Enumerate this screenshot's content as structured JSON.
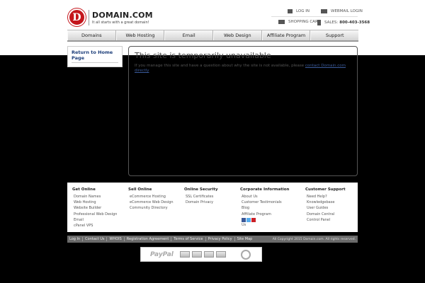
{
  "header": {
    "logo_letter": "D",
    "logo_name": "DOMAIN.COM",
    "logo_tagline": "It all starts with a great domain!",
    "login": "LOG IN",
    "webmail": "WEBMAIL LOGIN",
    "cart": "SHOPPING CART",
    "sales_label": "SALES:",
    "sales_phone": "800-403-3568"
  },
  "nav": [
    "Domains",
    "Web Hosting",
    "Email",
    "Web Design",
    "Affiliate Program",
    "Support"
  ],
  "sidebar": {
    "link": "Return to Home Page"
  },
  "main": {
    "title": "This site is temporarily unavailable",
    "message": "If you manage this site and have a question about why the site is not available, please",
    "contact_link": "contact Domain.com directly"
  },
  "footer": {
    "columns": [
      {
        "title": "Get Online",
        "links": [
          "Domain Names",
          "Web Hosting",
          "Website Builder",
          "Professional Web Design",
          "Email",
          "cPanel VPS"
        ]
      },
      {
        "title": "Sell Online",
        "links": [
          "eCommerce Hosting",
          "eCommerce Web Design",
          "Community Directory"
        ]
      },
      {
        "title": "Online Security",
        "links": [
          "SSL Certificates",
          "Domain Privacy"
        ]
      },
      {
        "title": "Corporate Information",
        "links": [
          "About Us",
          "Customer Testimonials",
          "Blog",
          "Affiliate Program",
          "Us"
        ]
      },
      {
        "title": "Customer Support",
        "links": [
          "Need Help?",
          "Knowledgebase",
          "User Guides",
          "Domain Central",
          "Control Panel"
        ]
      }
    ],
    "bar_links": [
      "Log In",
      "Contact Us",
      "WHOIS",
      "Registration Agreement",
      "Terms of Service",
      "Privacy Policy",
      "Site Map"
    ],
    "copyright": "All Copyright 2015 Domain.com. All rights reserved.",
    "paypal": "PayPal"
  },
  "colors": {
    "brand_red": "#c4161c",
    "link_blue": "#1d3e7a",
    "background": "#000000"
  }
}
